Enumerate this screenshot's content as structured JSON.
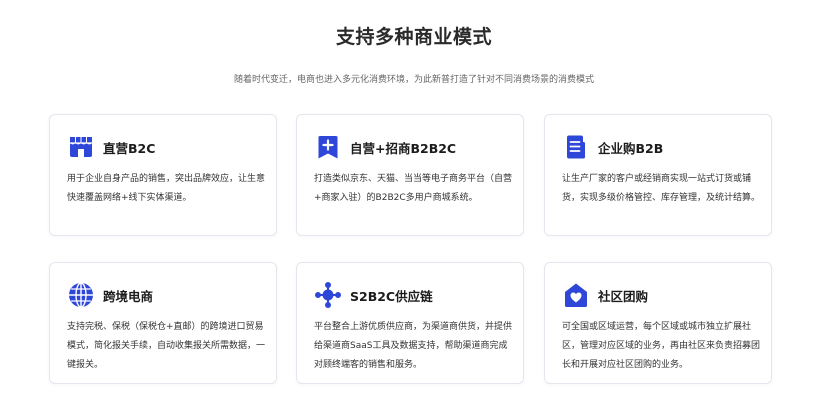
{
  "header": {
    "title": "支持多种商业模式",
    "subtitle": "随着时代变迁，电商也进入多元化消费环境，为此新普打造了针对不同消费场景的消费模式"
  },
  "colors": {
    "accent": "#2f47d8",
    "title": "#2a2a2a",
    "text": "#333333",
    "border": "#e3e6ec"
  },
  "cards": [
    {
      "icon": "storefront-icon",
      "title": "直营B2C",
      "desc": "用于企业自身产品的销售，突出品牌效应，让生意快速覆盖网络+线下实体渠道。"
    },
    {
      "icon": "bookmark-plus-icon",
      "title": "自营+招商B2B2C",
      "desc": "打造类似京东、天猫、当当等电子商务平台（自营+商家入驻）的B2B2C多用户商城系统。"
    },
    {
      "icon": "document-icon",
      "title": "企业购B2B",
      "desc": "让生产厂家的客户或经销商实现一站式订货或铺货，实现多级价格管控、库存管理，及统计结算。"
    },
    {
      "icon": "globe-icon",
      "title": "跨境电商",
      "desc": "支持完税、保税（保税仓+直邮）的跨境进口贸易模式，简化报关手续，自动收集报关所需数据，一键报关。"
    },
    {
      "icon": "network-icon",
      "title": "S2B2C供应链",
      "desc": "平台整合上游优质供应商，为渠道商供货，并提供给渠道商SaaS工具及数据支持，帮助渠道商完成对顾终端客的销售和服务。"
    },
    {
      "icon": "community-home-icon",
      "title": "社区团购",
      "desc": "可全国或区域运营，每个区域或城市独立扩展社区，管理对应区域的业务，再由社区来负责招募团长和开展对应社区团购的业务。"
    }
  ]
}
